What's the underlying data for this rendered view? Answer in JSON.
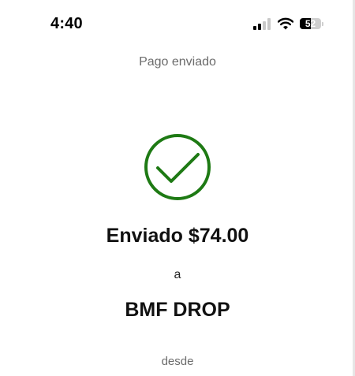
{
  "status_bar": {
    "time": "4:40",
    "signal_icon": "cellular-signal-icon",
    "signal_bars_active": 2,
    "signal_bars_total": 4,
    "wifi_icon": "wifi-icon",
    "battery_icon": "battery-icon",
    "battery_level": "52",
    "battery_fraction": 0.52
  },
  "screen": {
    "title": "Pago enviado",
    "status_icon": "checkmark-circle-icon",
    "accent_color": "#1e7a14",
    "amount_text": "Enviado $74.00",
    "to_label": "a",
    "recipient": "BMF DROP",
    "from_label": "desde"
  }
}
